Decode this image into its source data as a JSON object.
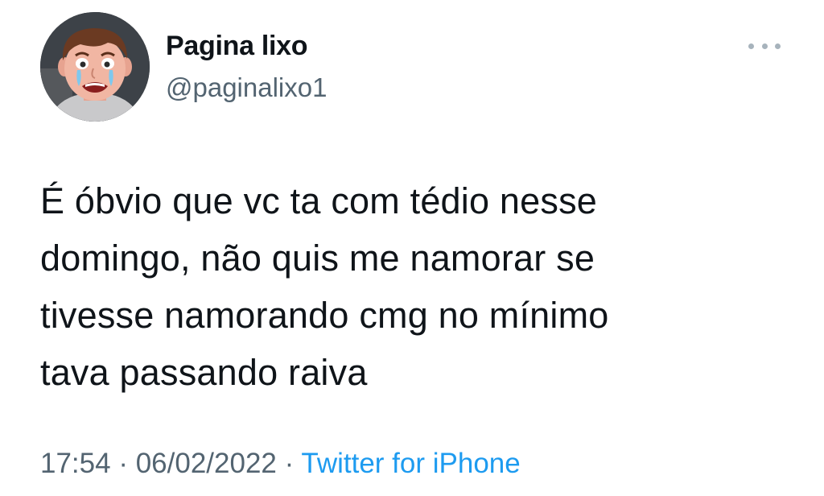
{
  "tweet": {
    "author_name": "Pagina lixo",
    "author_handle": "@paginalixo1",
    "avatar_icon": "crying-cartoon-face-icon",
    "more_icon": "more-options-icon",
    "text": "É óbvio que vc ta com tédio nesse\ndomingo, não quis me namorar se\ntivesse namorando cmg no mínimo\ntava passando raiva",
    "time": "17:54",
    "separator": "·",
    "date": "06/02/2022",
    "source": "Twitter for iPhone"
  },
  "colors": {
    "text": "#0f1419",
    "secondary": "#536471",
    "link": "#1d9bf0"
  }
}
